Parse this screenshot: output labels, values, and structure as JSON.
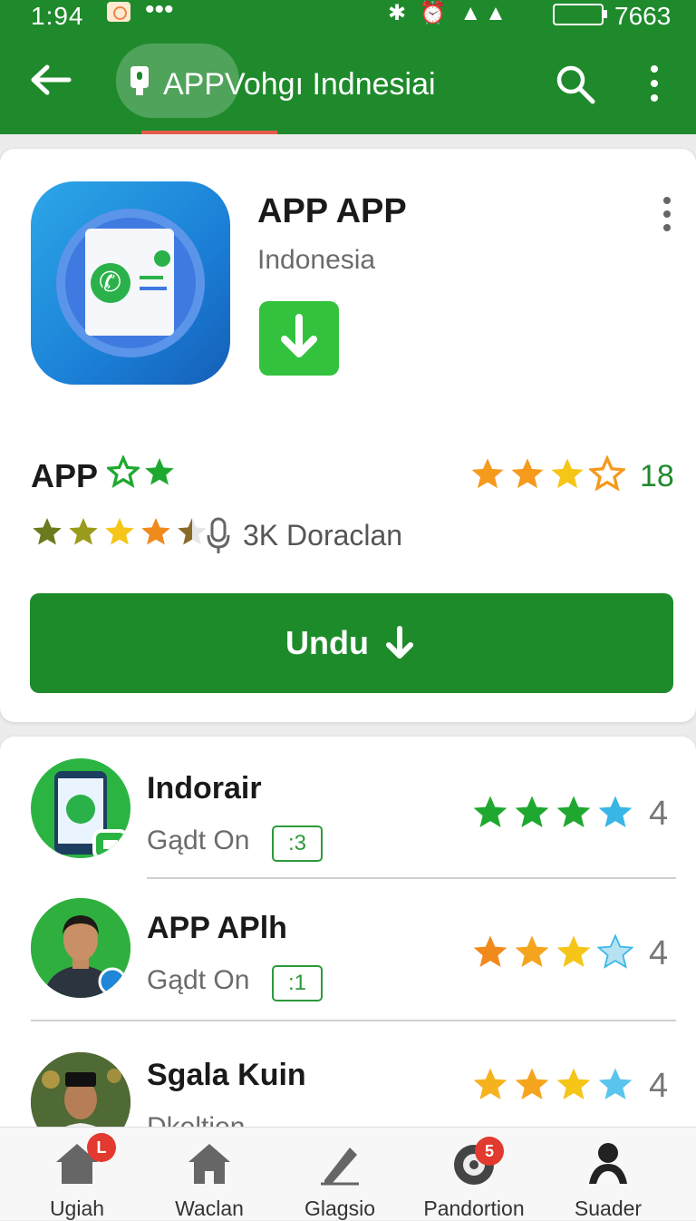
{
  "status_bar": {
    "time": "1:94",
    "dots": "•••",
    "icons": "✱ ⏰ ▲▲",
    "battery": "7663"
  },
  "app_bar": {
    "title": "APPVohgı Indnesiai"
  },
  "app": {
    "name": "APP APP",
    "subtitle": "Indonesia",
    "rating_label": "APP",
    "rating_number": "18",
    "downloads": "3K Doraclan",
    "download_button": "Undu"
  },
  "list": [
    {
      "name": "Indorair",
      "sub": "Gądt On",
      "badge": ":3",
      "count": "4"
    },
    {
      "name": "APP APlh",
      "sub": "Gądt On",
      "badge": ":1",
      "count": "4"
    },
    {
      "name": "Sgala Kuin",
      "sub": "Dkeltion",
      "count": "4"
    }
  ],
  "bottom_nav": [
    {
      "label": "Ugiah",
      "badge": "L"
    },
    {
      "label": "Waclan"
    },
    {
      "label": "Glagsio"
    },
    {
      "label": "Pandortion",
      "badge": "5"
    },
    {
      "label": "Suader"
    }
  ],
  "colors": {
    "brand_green": "#1f8a2c",
    "star_orange": "#f59a1d",
    "star_yellow": "#f5c518",
    "star_green": "#1ea82f",
    "star_blue": "#38b6e6"
  }
}
